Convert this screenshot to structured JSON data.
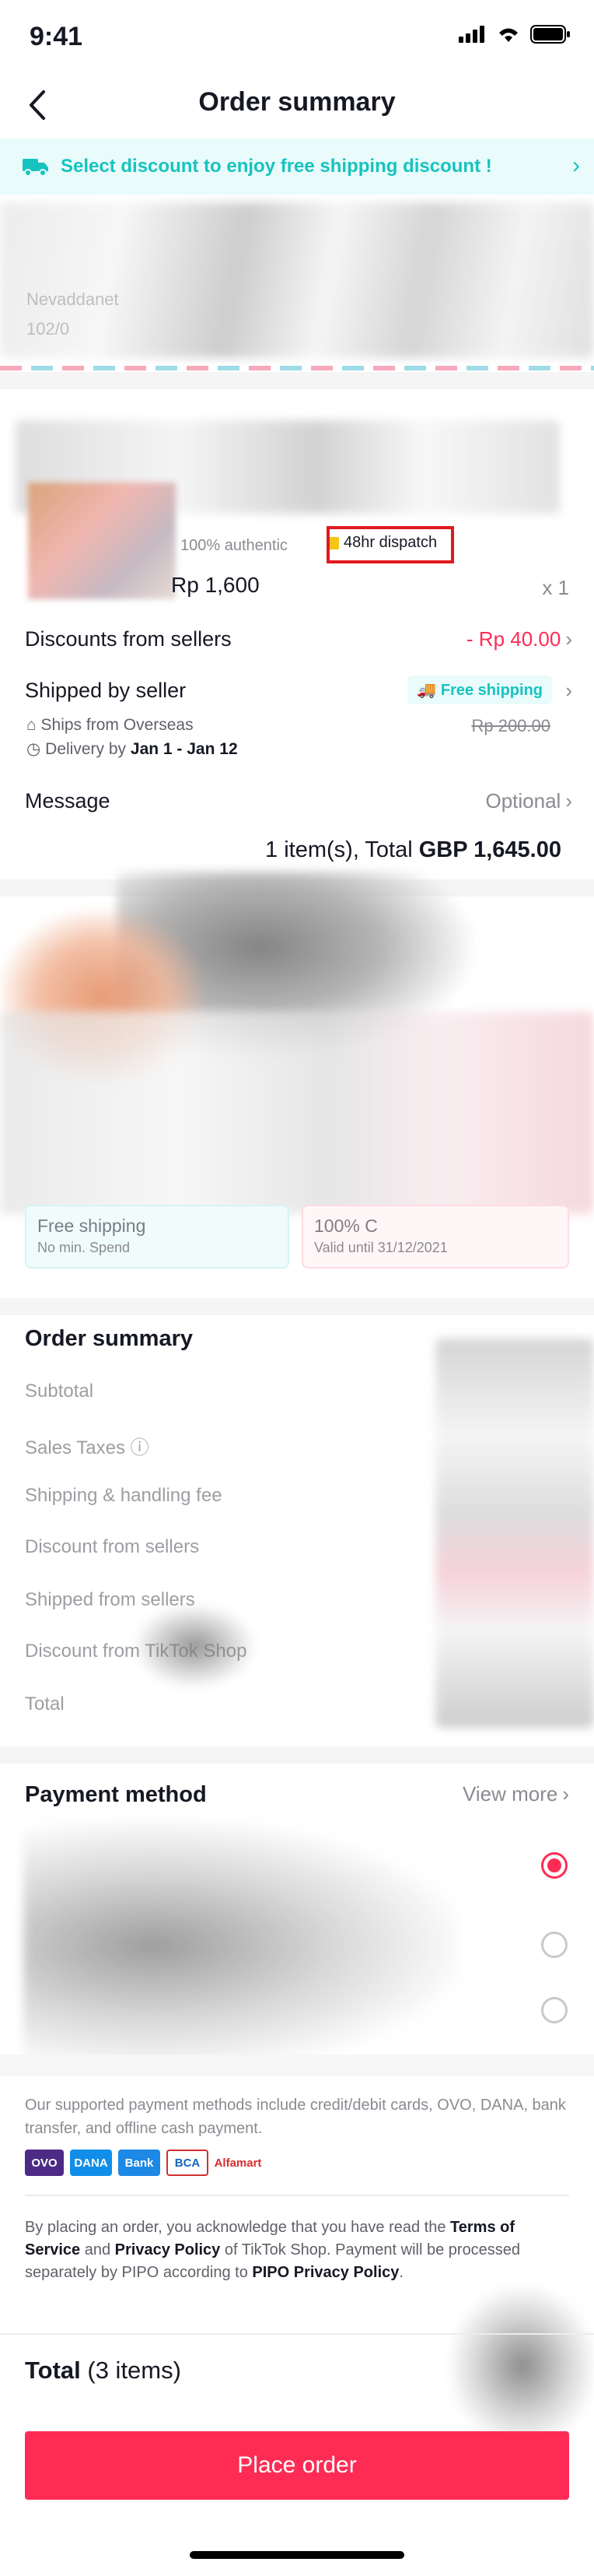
{
  "status_bar": {
    "time": "9:41"
  },
  "header": {
    "title": "Order summary"
  },
  "promo_banner": {
    "text": "Select discount  to enjoy free shipping discount !"
  },
  "address": {
    "name_partial": "Nevaddanet",
    "line_partial": "102/0"
  },
  "product": {
    "tags": {
      "authentic": "100% authentic",
      "dispatch": "48hr dispatch"
    },
    "price": "Rp 1,600",
    "quantity": "x 1"
  },
  "seller_section": {
    "discounts_label": "Discounts from sellers",
    "discounts_value": "- Rp 40.00",
    "shipped_label": "Shipped by seller",
    "free_shipping_badge": "Free shipping",
    "ships_from": "Ships from Overseas",
    "delivery_prefix": "Delivery by",
    "delivery_dates": "Jan 1 - Jan 12",
    "original_shipping": "Rp 200.00",
    "message_label": "Message",
    "message_placeholder": "Optional",
    "items_total_prefix": "1 item(s), Total",
    "items_total_value": "GBP 1,645.00"
  },
  "vouchers": {
    "coupon_1_title": "Free shipping",
    "coupon_1_sub": "No min. Spend",
    "coupon_2_title": "100% C",
    "coupon_2_sub": "Valid until 31/12/2021"
  },
  "order_summary": {
    "title": "Order summary",
    "rows": [
      "Subtotal",
      "Sales Taxes",
      "Shipping & handling fee",
      "Discount from sellers",
      "Shipped from sellers",
      "Discount from TikTok Shop",
      "Total"
    ]
  },
  "payment": {
    "title": "Payment method",
    "view_more": "View more",
    "methods_note": "Our supported payment methods include credit/debit cards, OVO, DANA, bank transfer, and offline cash payment.",
    "logos": [
      "OVO",
      "DANA",
      "Bank",
      "BCA",
      "Alfamart"
    ],
    "legal_1": "By placing an order, you acknowledge that you have read the ",
    "legal_terms": "Terms of Service",
    "legal_2": " and ",
    "legal_privacy": "Privacy Policy",
    "legal_3": " of TikTok Shop. Payment will be processed separately by PIPO according to ",
    "legal_pipo": "PIPO Privacy Policy",
    "legal_4": "."
  },
  "footer": {
    "total_label": "Total",
    "total_items": "(3 items)",
    "place_order": "Place order"
  },
  "colors": {
    "accent": "#fe2c55",
    "teal": "#17c3bf",
    "highlight_box": "#e1191e"
  }
}
